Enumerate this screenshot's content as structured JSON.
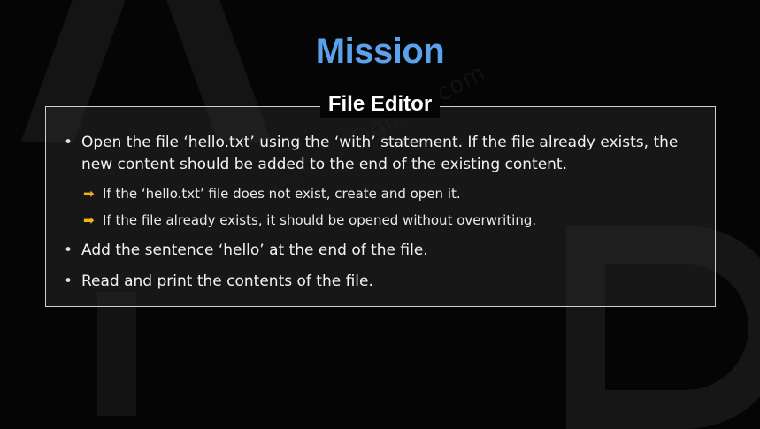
{
  "header": {
    "title": "Mission"
  },
  "panel": {
    "title": "File Editor",
    "items": [
      {
        "text": "Open the file ‘hello.txt’ using the ‘with’ statement. If the file already exists, the new content should be added to the end of the existing content.",
        "subitems": [
          "If the ‘hello.txt’ file does not exist, create and open it.",
          "If the file already exists, it should be opened without overwriting."
        ]
      },
      {
        "text": "Add the sentence ‘hello’ at the end of the file."
      },
      {
        "text": "Read and print the contents of the file."
      }
    ]
  },
  "bullet_glyph": "•",
  "arrow_glyph": "➡",
  "colors": {
    "title": "#5aa3ec",
    "arrow": "#f2b31c",
    "border": "#cfcfcf",
    "background": "#050505"
  }
}
